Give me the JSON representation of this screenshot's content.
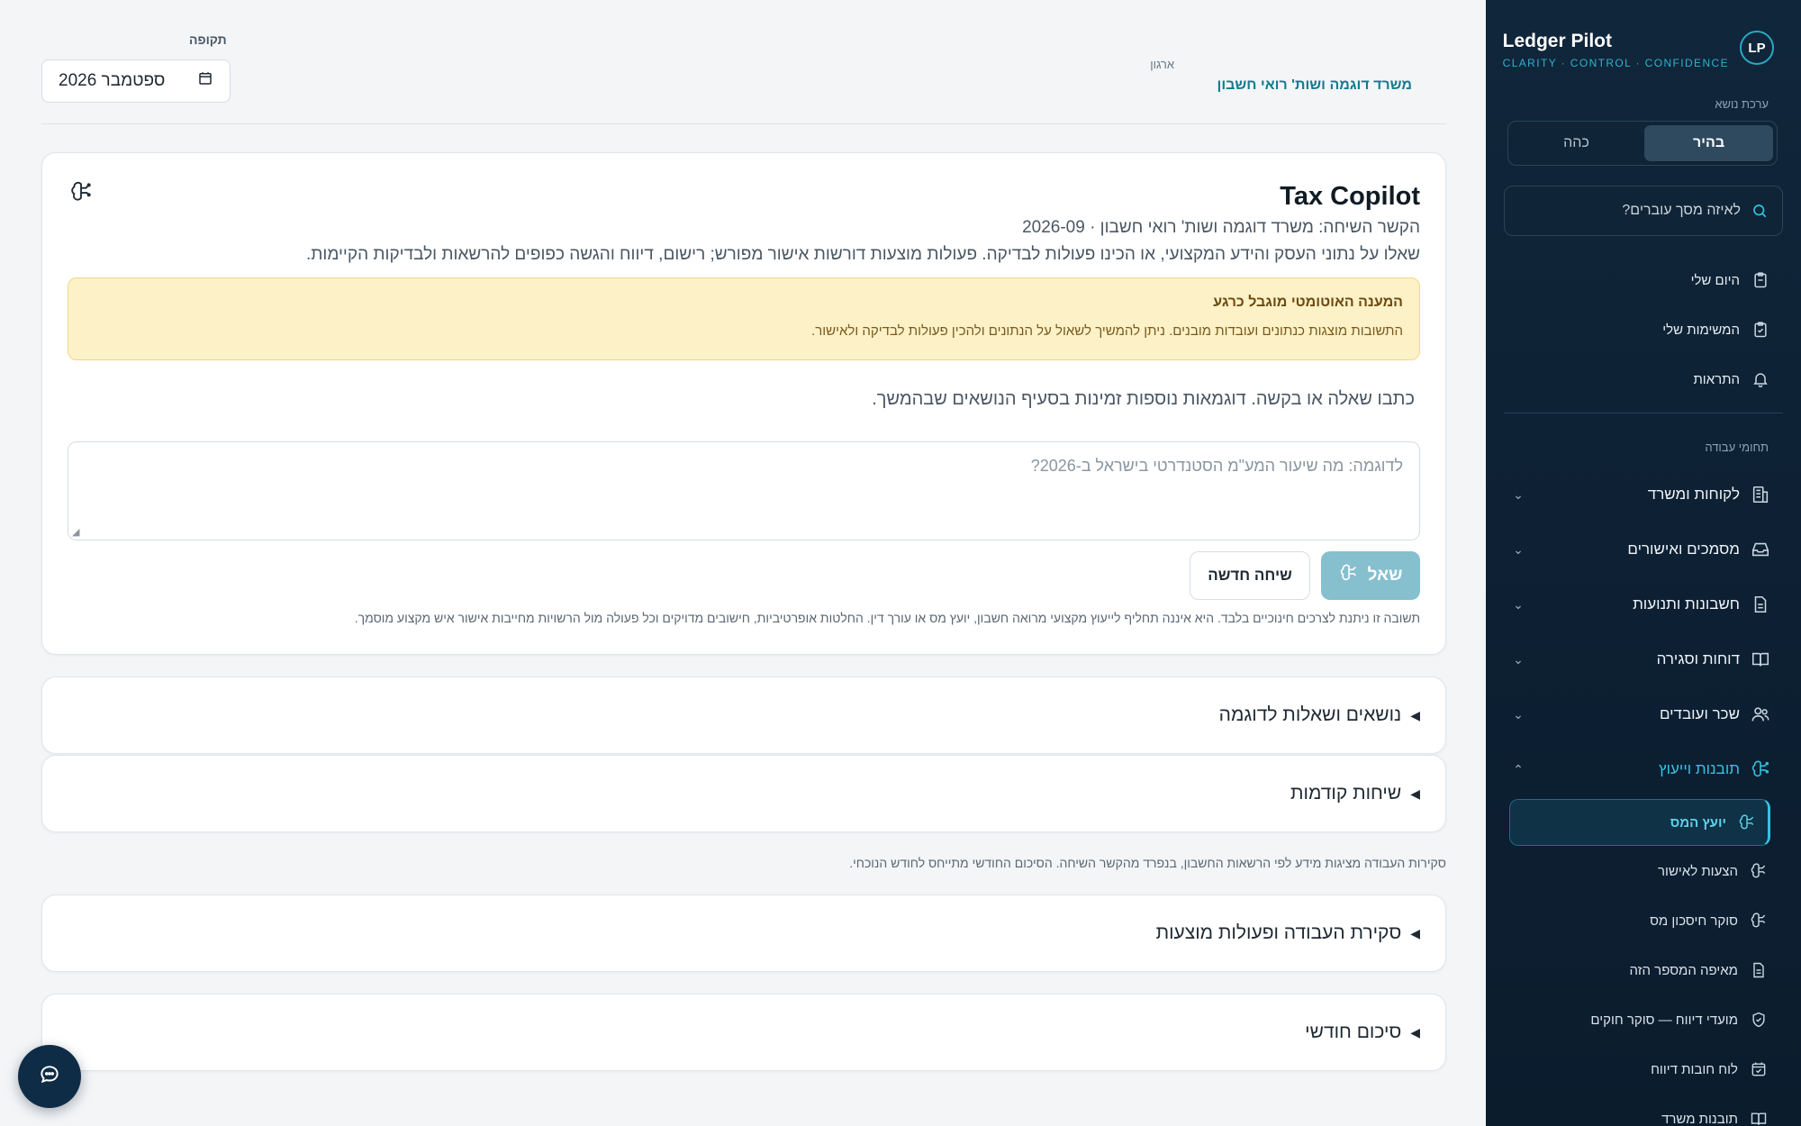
{
  "brand": {
    "logo_text": "LP",
    "name": "Ledger Pilot",
    "tagline": "CLARITY · CONTROL · CONFIDENCE"
  },
  "theme": {
    "label": "ערכת נושא",
    "light": "בהיר",
    "dark": "כהה",
    "selected": "light"
  },
  "search": {
    "placeholder": "לאיזה מסך עוברים?"
  },
  "top_nav": [
    {
      "label": "היום שלי",
      "icon": "clipboard-icon"
    },
    {
      "label": "המשימות שלי",
      "icon": "clipboard-check-icon"
    },
    {
      "label": "התראות",
      "icon": "bell-icon"
    }
  ],
  "work_areas_label": "תחומי עבודה",
  "groups": [
    {
      "label": "לקוחות ומשרד",
      "icon": "building-icon",
      "expanded": false
    },
    {
      "label": "מסמכים ואישורים",
      "icon": "inbox-icon",
      "expanded": false
    },
    {
      "label": "חשבונות ותנועות",
      "icon": "document-icon",
      "expanded": false
    },
    {
      "label": "דוחות וסגירה",
      "icon": "book-icon",
      "expanded": false
    },
    {
      "label": "שכר ועובדים",
      "icon": "users-icon",
      "expanded": false
    },
    {
      "label": "תובנות וייעוץ",
      "icon": "brain-icon",
      "expanded": true
    }
  ],
  "sub_items": [
    {
      "label": "יועץ המס",
      "icon": "brain-icon",
      "active": true
    },
    {
      "label": "הצעות לאישור",
      "icon": "brain-icon",
      "active": false
    },
    {
      "label": "סוקר חיסכון מס",
      "icon": "brain-icon",
      "active": false
    },
    {
      "label": "מאיפה המספר הזה",
      "icon": "document-icon",
      "active": false
    },
    {
      "label": "מועדי דיווח — סוקר חוקים",
      "icon": "shield-check-icon",
      "active": false
    },
    {
      "label": "לוח חובות דיווח",
      "icon": "calendar-check-icon",
      "active": false
    },
    {
      "label": "תובנות משרד",
      "icon": "book-icon",
      "active": false
    }
  ],
  "header": {
    "period_label": "תקופה",
    "period_value": "ספטמבר 2026",
    "org_label": "ארגון",
    "org_name": "משרד דוגמה ושות' רואי חשבון"
  },
  "copilot": {
    "title": "Tax Copilot",
    "context": "הקשר השיחה: משרד דוגמה ושות' רואי חשבון · 2026-09",
    "description": "שאלו על נתוני העסק והידע המקצועי, או הכינו פעולות לבדיקה. פעולות מוצעות דורשות אישור מפורש; רישום, דיווח והגשה כפופים להרשאות ולבדיקות הקיימות.",
    "alert_title": "המענה האוטומטי מוגבל כרגע",
    "alert_body": "התשובות מוצגות כנתונים ועובדות מובנים. ניתן להמשיך לשאול על הנתונים ולהכין פעולות לבדיקה ולאישור.",
    "prompt_hint": "כתבו שאלה או בקשה. דוגמאות נוספות זמינות בסעיף הנושאים שבהמשך.",
    "input_placeholder": "לדוגמה: מה שיעור המע\"מ הסטנדרטי בישראל ב-2026?",
    "input_value": "",
    "ask_label": "שאל",
    "new_chat_label": "שיחה חדשה",
    "disclaimer": "תשובה זו ניתנת לצרכים חינוכיים בלבד. היא איננה תחליף לייעוץ מקצועי מרואה חשבון, יועץ מס או עורך דין. החלטות אופרטיביות, חישובים מדויקים וכל פעולה מול הרשויות מחייבות אישור איש מקצוע מוסמך."
  },
  "accordions": {
    "topics": "נושאים ושאלות לדוגמה",
    "previous": "שיחות קודמות",
    "note": "סקירות העבודה מציגות מידע לפי הרשאות החשבון, בנפרד מהקשר השיחה. הסיכום החודשי מתייחס לחודש הנוכחי.",
    "overview": "סקירת העבודה ופעולות מוצעות",
    "monthly": "סיכום חודשי"
  },
  "colors": {
    "accent": "#35c2e0",
    "sidebar_bg": "#0d2033",
    "alert_bg": "#fdf1c7",
    "ask_button": "#86bfce",
    "org_link": "#137a8f"
  }
}
